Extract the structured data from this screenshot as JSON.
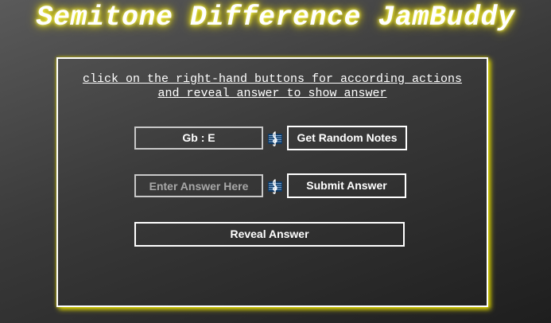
{
  "header": {
    "title": "Semitone Difference JamBuddy"
  },
  "panel": {
    "instructions_line1": "click on the right-hand buttons for according actions",
    "instructions_line2": "and reveal answer to show answer"
  },
  "notes": {
    "display_value": "Gb : E",
    "icon": "treble-clef-icon",
    "random_button_label": "Get Random Notes"
  },
  "answer": {
    "input_value": "",
    "input_placeholder": "Enter Answer Here",
    "icon": "treble-clef-icon",
    "submit_button_label": "Submit Answer"
  },
  "reveal": {
    "button_label": "Reveal Answer"
  },
  "colors": {
    "title_glow": "#f5e600",
    "panel_glow": "#e0d800",
    "clef_icon": "#1e7fd6",
    "text": "#ffffff"
  }
}
